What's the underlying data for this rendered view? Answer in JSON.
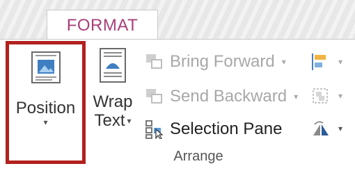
{
  "tabs": {
    "format_label": "FORMAT"
  },
  "buttons": {
    "position": {
      "label": "Position",
      "caret": "▾"
    },
    "wrap_text": {
      "label_line1": "Wrap",
      "label_line2": "Text",
      "caret": "▾"
    },
    "bring_forward": {
      "label": "Bring Forward",
      "caret": "▾",
      "enabled": false
    },
    "send_backward": {
      "label": "Send Backward",
      "caret": "▾",
      "enabled": false
    },
    "selection_pane": {
      "label": "Selection Pane",
      "enabled": true
    }
  },
  "group": {
    "label": "Arrange"
  },
  "colors": {
    "accent_tab": "#a93f79",
    "highlight_border": "#b2211f",
    "disabled_text": "#a8a8a8"
  },
  "icons": [
    "position-icon",
    "wrap-text-icon",
    "bring-forward-icon",
    "send-backward-icon",
    "selection-pane-icon",
    "align-icon",
    "group-icon",
    "rotate-icon"
  ]
}
